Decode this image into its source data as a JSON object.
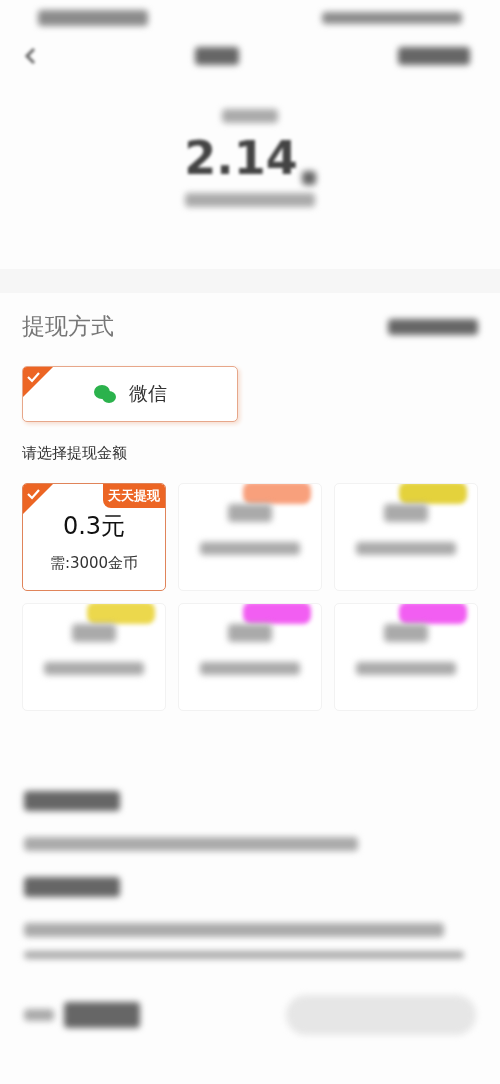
{
  "header": {
    "balance": "2.14"
  },
  "withdraw_method": {
    "title": "提现方式",
    "options": [
      {
        "label": "微信",
        "selected": true
      }
    ]
  },
  "amount_prompt": "请选择提现金额",
  "amounts": [
    {
      "badge": "天天提现",
      "amount": "0.3元",
      "cost": "需:3000金币",
      "selected": true,
      "color": "#ec6524"
    },
    {
      "selected": false,
      "color": "#f8a07c"
    },
    {
      "selected": false,
      "color": "#e4d23c"
    },
    {
      "selected": false,
      "color": "#ecd84c"
    },
    {
      "selected": false,
      "color": "#f25ef2"
    },
    {
      "selected": false,
      "color": "#f25ef2"
    }
  ]
}
